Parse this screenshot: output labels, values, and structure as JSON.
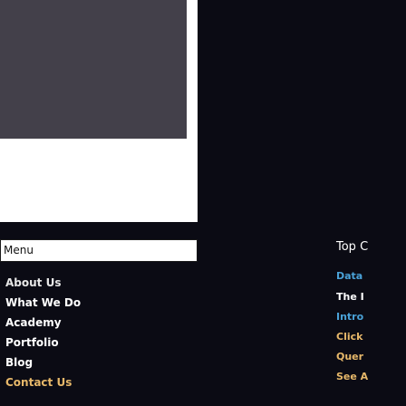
{
  "menu": {
    "header_label": "Menu",
    "items": [
      {
        "label": "About Us"
      },
      {
        "label": "What We Do"
      },
      {
        "label": "Academy"
      },
      {
        "label": "Portfolio"
      },
      {
        "label": "Blog"
      },
      {
        "label": "Contact Us"
      }
    ]
  },
  "right_column": {
    "title": "Top C",
    "items": [
      {
        "label": "Data"
      },
      {
        "label": "The I"
      },
      {
        "label": "Intro"
      },
      {
        "label": "Click"
      },
      {
        "label": "Quer"
      },
      {
        "label": "See A"
      }
    ]
  },
  "colors": {
    "background": "#0b0b14",
    "link_blue": "#4aa2d8",
    "link_gold": "#e7b86a",
    "text_white": "#ffffff"
  }
}
